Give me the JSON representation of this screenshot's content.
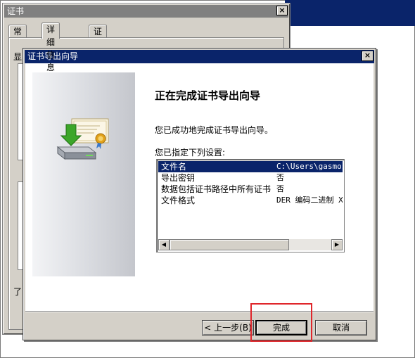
{
  "cert_window": {
    "title": "证书",
    "close_glyph": "×",
    "tabs": [
      "常规",
      "详细信息",
      "证书路径"
    ],
    "active_tab": "详细信息",
    "fragment_1": "显",
    "fragment_2": "了"
  },
  "wizard": {
    "title": "证书导出向导",
    "close_glyph": "×",
    "heading": "正在完成证书导出向导",
    "description": "您已成功地完成证书导出向导。",
    "settings_label": "您已指定下列设置:",
    "settings": [
      {
        "name": "文件名",
        "value": "C:\\Users\\gasmoss"
      },
      {
        "name": "导出密钥",
        "value": "否"
      },
      {
        "name": "数据包括证书路径中所有证书",
        "value": "否"
      },
      {
        "name": "文件格式",
        "value": "DER 编码二进制 X"
      }
    ],
    "scroll_left_glyph": "◀",
    "scroll_right_glyph": "▶",
    "buttons": {
      "back": "< 上一步(B)",
      "finish": "完成",
      "cancel": "取消"
    },
    "icon": "certificate-export-icon"
  },
  "colors": {
    "titlebar_active": "#0a246a",
    "titlebar_inactive": "#808080",
    "dialog_face": "#d4d0c8",
    "highlight_border": "#e0262b",
    "seal_gold": "#e2a21a",
    "arrow_green": "#3ca629"
  }
}
